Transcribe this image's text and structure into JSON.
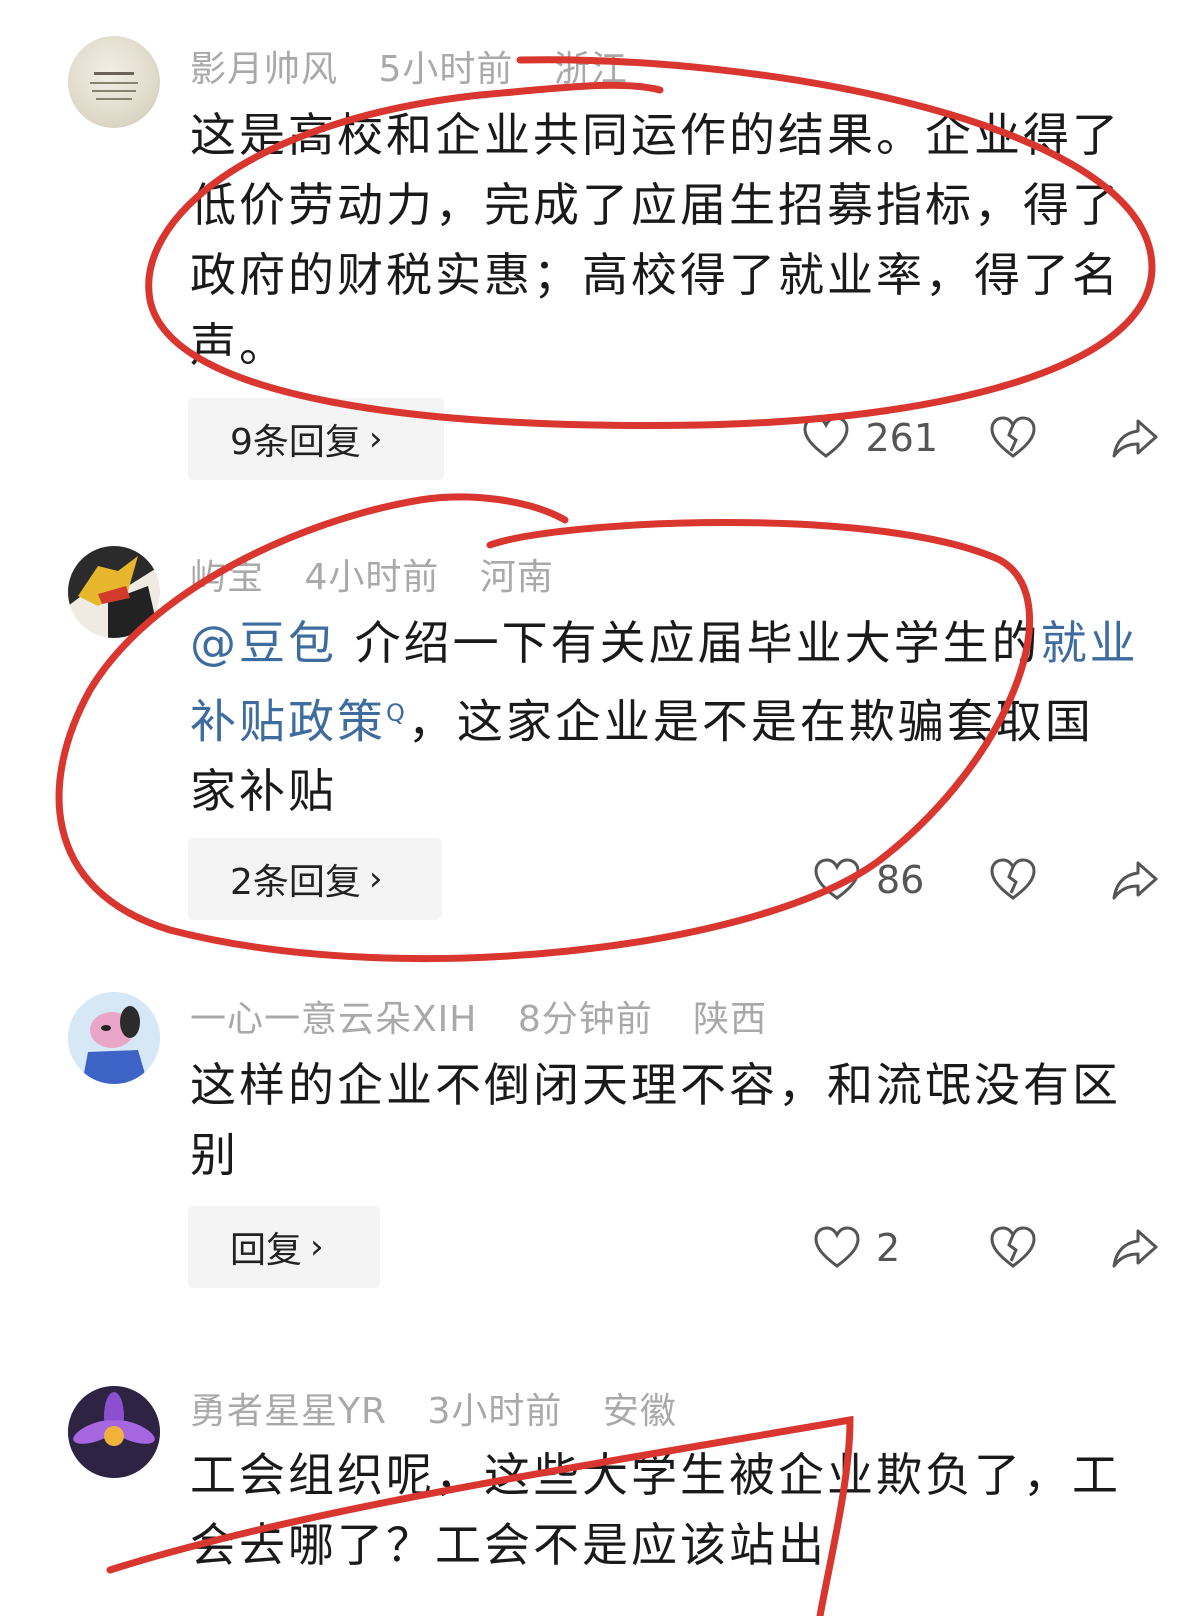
{
  "comments": [
    {
      "avatar_icon": "avatar-calligraphy-icon",
      "username": "影月帅风",
      "time": "5小时前",
      "location": "浙江",
      "text": "这是高校和企业共同运作的结果。企业得了低价劳动力，完成了应届生招募指标，得了政府的财税实惠；高校得了就业率，得了名声。",
      "reply_label": "9条回复",
      "likes": "261"
    },
    {
      "avatar_icon": "avatar-portrait-icon",
      "username": "屿宝",
      "time": "4小时前",
      "location": "河南",
      "mention": "@豆包",
      "text_before_link": " 介绍一下有关应届毕业大学生的",
      "link_text": "就业补贴政策",
      "search_mark": "Q",
      "text_after_link": "，这家企业是不是在欺骗套取国家补贴",
      "reply_label": "2条回复",
      "likes": "86"
    },
    {
      "avatar_icon": "avatar-cartoon-dog-icon",
      "username": "一心一意云朵XIH",
      "time": "8分钟前",
      "location": "陕西",
      "text": "这样的企业不倒闭天理不容，和流氓没有区别",
      "reply_label": "回复",
      "likes": "2"
    },
    {
      "avatar_icon": "avatar-purple-flower-icon",
      "username": "勇者星星YR",
      "time": "3小时前",
      "location": "安徽",
      "text": "工会组织呢，这些大学生被企业欺负了，工会去哪了？工会不是应该站出"
    }
  ],
  "icons": {
    "like": "heart-icon",
    "dislike": "broken-heart-icon",
    "share": "share-arrow-icon",
    "reply_chevron": "chevron-right-icon"
  },
  "colors": {
    "annotation_red": "#d9362f",
    "link_blue": "#3e6c9f",
    "meta_gray": "#a9a9a9"
  }
}
